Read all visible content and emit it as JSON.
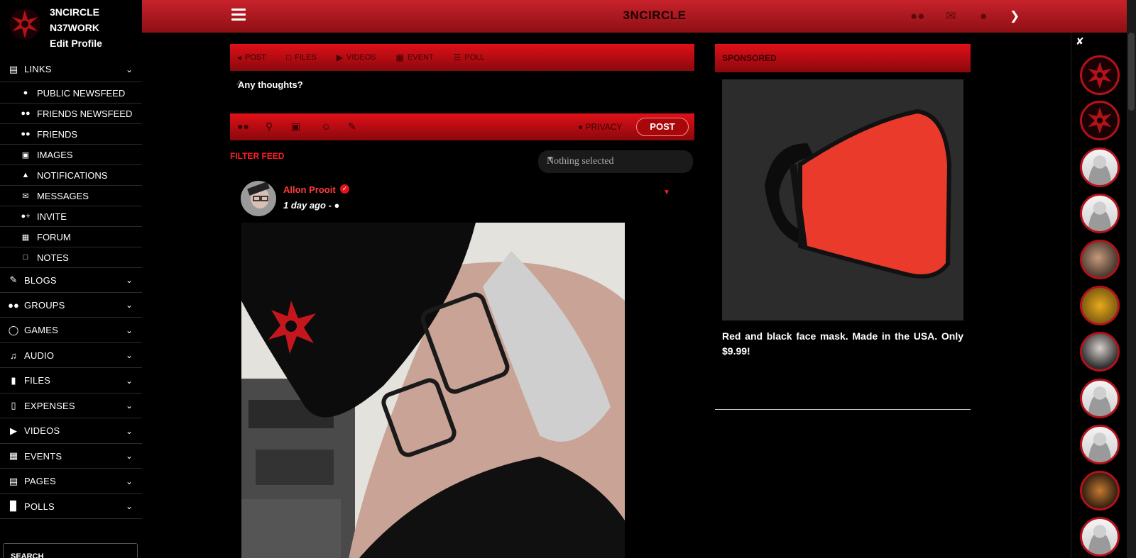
{
  "brand": {
    "line1": "3NCIRCLE",
    "line2": "N37WORK",
    "edit_profile": "Edit Profile"
  },
  "sidebar": {
    "links_label": "LINKS",
    "links_items": [
      {
        "label": "PUBLIC NEWSFEED",
        "icon": "globe-icon"
      },
      {
        "label": "FRIENDS NEWSFEED",
        "icon": "users-icon"
      },
      {
        "label": "FRIENDS",
        "icon": "users-icon"
      },
      {
        "label": "IMAGES",
        "icon": "image-icon"
      },
      {
        "label": "NOTIFICATIONS",
        "icon": "bell-icon"
      },
      {
        "label": "MESSAGES",
        "icon": "envelope-icon"
      },
      {
        "label": "INVITE",
        "icon": "user-plus-icon"
      },
      {
        "label": "FORUM",
        "icon": "grid-icon"
      },
      {
        "label": "NOTES",
        "icon": "note-icon"
      }
    ],
    "sections": [
      {
        "label": "BLOGS",
        "icon": "edit-icon"
      },
      {
        "label": "GROUPS",
        "icon": "users-icon"
      },
      {
        "label": "GAMES",
        "icon": "gamepad-icon"
      },
      {
        "label": "AUDIO",
        "icon": "audio-file-icon"
      },
      {
        "label": "FILES",
        "icon": "file-icon"
      },
      {
        "label": "EXPENSES",
        "icon": "mobile-icon"
      },
      {
        "label": "VIDEOS",
        "icon": "video-icon"
      },
      {
        "label": "EVENTS",
        "icon": "calendar-icon"
      },
      {
        "label": "PAGES",
        "icon": "page-icon"
      },
      {
        "label": "POLLS",
        "icon": "bar-chart-icon"
      }
    ],
    "search_label": "SEARCH"
  },
  "topbar": {
    "title": "3NCIRCLE"
  },
  "composer": {
    "tabs": [
      "POST",
      "FILES",
      "VIDEOS",
      "EVENT",
      "POLL"
    ],
    "placeholder": "Any thoughts?",
    "privacy_label": "PRIVACY",
    "post_label": "POST"
  },
  "filter": {
    "label": "FILTER FEED",
    "selected": "Nothing selected"
  },
  "post": {
    "author": "Allon Prooit",
    "time": "1 day ago - "
  },
  "sponsored": {
    "header": "SPONSORED",
    "ad_text": "Red and black face mask. Made in the USA. Only $9.99!"
  },
  "colors": {
    "accent": "#e01018",
    "accent_dark": "#8a080c",
    "link": "#ff3b3b"
  }
}
